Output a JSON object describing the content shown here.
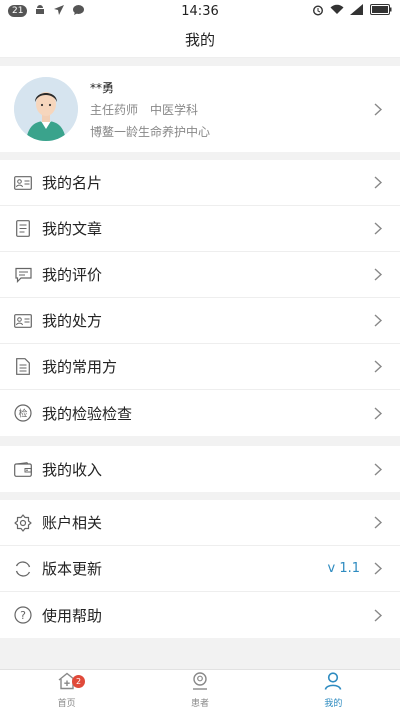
{
  "status_bar": {
    "notif_count": "21",
    "time": "14:36"
  },
  "header": {
    "title": "我的"
  },
  "profile": {
    "name": "**勇",
    "position": "主任药师",
    "department": "中医学科",
    "organization": "博鳌一龄生命养护中心"
  },
  "menu_group_1": [
    {
      "label": "我的名片",
      "icon": "id-card-icon"
    },
    {
      "label": "我的文章",
      "icon": "document-icon"
    },
    {
      "label": "我的评价",
      "icon": "comment-icon"
    },
    {
      "label": "我的处方",
      "icon": "prescription-card-icon"
    },
    {
      "label": "我的常用方",
      "icon": "common-prescription-icon"
    },
    {
      "label": "我的检验检查",
      "icon": "lab-test-icon",
      "icon_text": "检"
    }
  ],
  "menu_group_2": [
    {
      "label": "我的收入",
      "icon": "wallet-icon"
    }
  ],
  "menu_group_3": [
    {
      "label": "账户相关",
      "icon": "gear-icon"
    },
    {
      "label": "版本更新",
      "icon": "refresh-icon",
      "value": "v 1.1"
    },
    {
      "label": "使用帮助",
      "icon": "help-icon",
      "icon_text": "?"
    }
  ],
  "tabbar": {
    "home": {
      "label": "首页",
      "badge": "2"
    },
    "patients": {
      "label": "患者"
    },
    "mine": {
      "label": "我的"
    }
  },
  "colors": {
    "accent": "#2e8bc0",
    "badge": "#e04a3a"
  }
}
